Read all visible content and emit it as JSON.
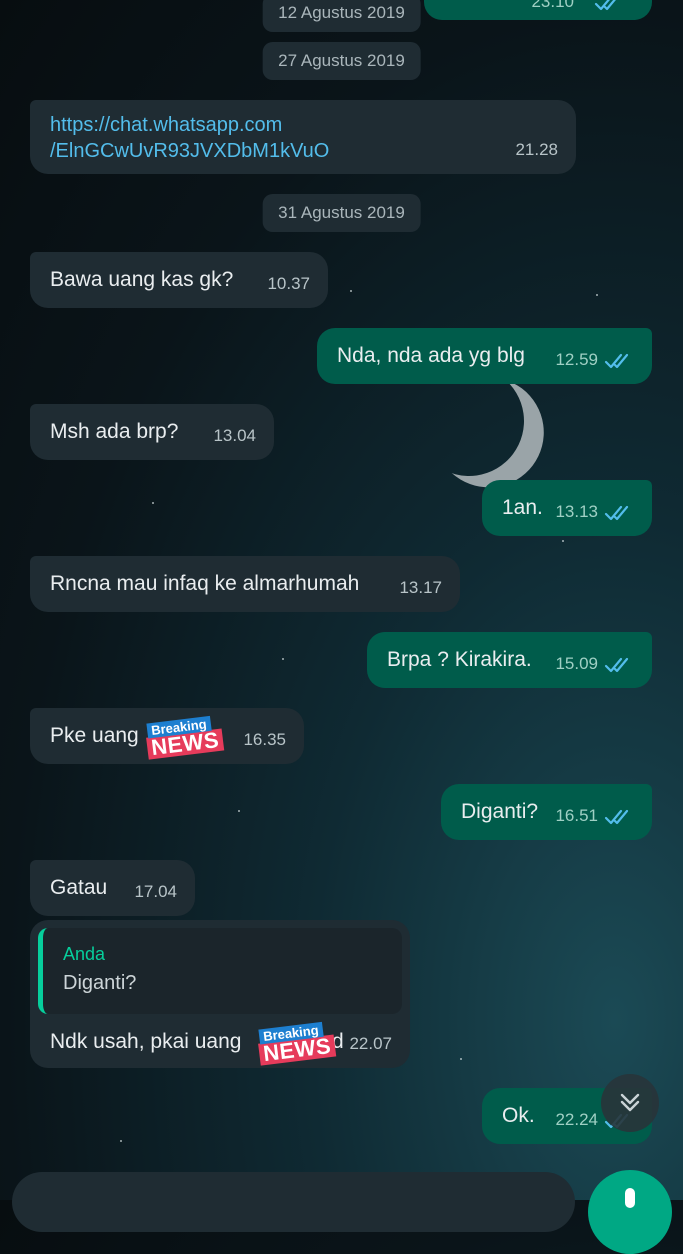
{
  "dates": [
    "12 Agustus 2019",
    "27 Agustus 2019",
    "31 Agustus 2019"
  ],
  "top_partial_time": "23.10",
  "messages": [
    {
      "dir": "in",
      "link_line1": "https://chat.whatsapp.com",
      "link_line2": "/ElnGCwUvR93JVXDbM1kVuO",
      "time": "21.28"
    },
    {
      "dir": "in",
      "text": "Bawa uang kas gk?",
      "time": "10.37"
    },
    {
      "dir": "out",
      "text": "Nda, nda ada yg blg",
      "time": "12.59"
    },
    {
      "dir": "in",
      "text": "Msh ada brp?",
      "time": "13.04"
    },
    {
      "dir": "out",
      "text": "1an.",
      "time": "13.13"
    },
    {
      "dir": "in",
      "text": "Rncna mau infaq ke almarhumah",
      "time": "13.17"
    },
    {
      "dir": "out",
      "text": "Brpa ? Kirakira.",
      "time": "15.09"
    },
    {
      "dir": "in",
      "text": "Pke uang",
      "time": "16.35"
    },
    {
      "dir": "out",
      "text": "Diganti?",
      "time": "16.51"
    },
    {
      "dir": "in",
      "text": "Gatau",
      "time": "17.04"
    },
    {
      "dir": "in",
      "quote_name": "Anda",
      "quote_text": "Diganti?",
      "text": "Ndk usah, pkai uang",
      "text_tail": "d",
      "time": "22.07"
    },
    {
      "dir": "out",
      "text": "Ok.",
      "time": "22.24"
    }
  ],
  "sticker": {
    "top": "Breaking",
    "bottom": "NEWS"
  },
  "colors": {
    "incoming_bubble": "#1f2c33",
    "outgoing_bubble": "#005c4b",
    "link": "#53bdeb",
    "quote_accent": "#06cf9c",
    "tick_read": "#53bdeb",
    "mic_button": "#00a884"
  },
  "icons": [
    "double-check-icon",
    "chevron-down-double-icon",
    "mic-icon"
  ]
}
